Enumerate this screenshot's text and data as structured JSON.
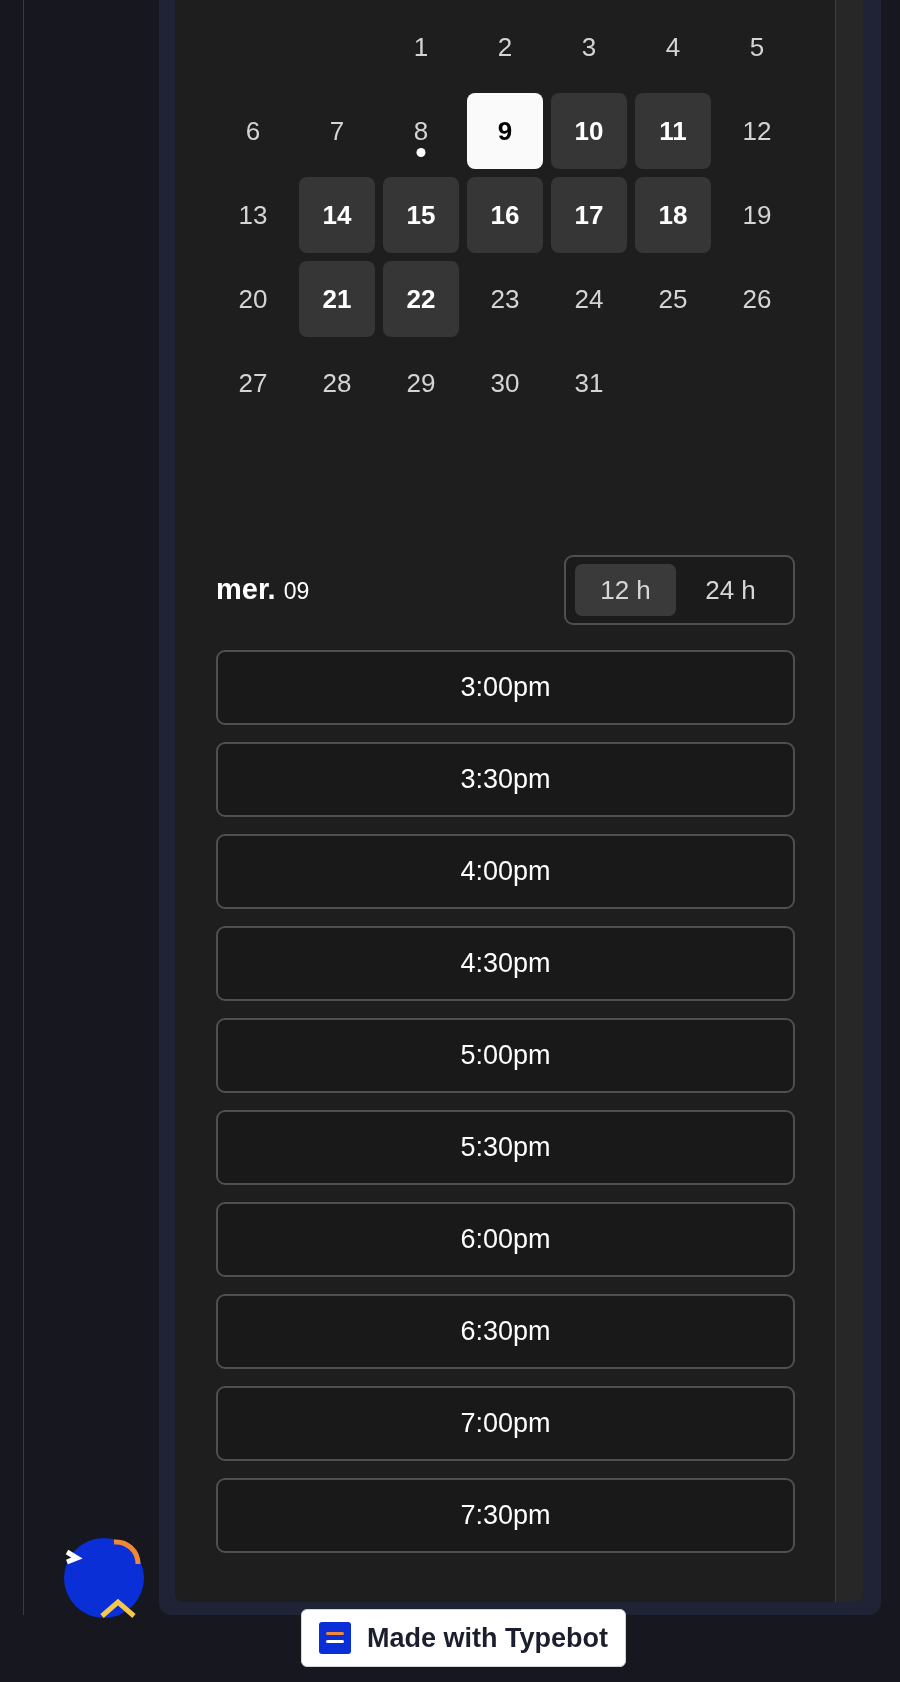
{
  "calendar": {
    "weeks": [
      {
        "kind": "first",
        "days": [
          {
            "label": "1",
            "selected": false,
            "available": false,
            "today": false
          },
          {
            "label": "2",
            "selected": false,
            "available": false,
            "today": false
          },
          {
            "label": "3",
            "selected": false,
            "available": false,
            "today": false
          },
          {
            "label": "4",
            "selected": false,
            "available": false,
            "today": false
          },
          {
            "label": "5",
            "selected": false,
            "available": false,
            "today": false
          }
        ]
      },
      {
        "kind": "full",
        "days": [
          {
            "label": "6",
            "selected": false,
            "available": false,
            "today": false
          },
          {
            "label": "7",
            "selected": false,
            "available": false,
            "today": false
          },
          {
            "label": "8",
            "selected": false,
            "available": false,
            "today": true
          },
          {
            "label": "9",
            "selected": true,
            "available": true,
            "today": false
          },
          {
            "label": "10",
            "selected": false,
            "available": true,
            "today": false
          },
          {
            "label": "11",
            "selected": false,
            "available": true,
            "today": false
          },
          {
            "label": "12",
            "selected": false,
            "available": false,
            "today": false
          }
        ]
      },
      {
        "kind": "full",
        "days": [
          {
            "label": "13",
            "selected": false,
            "available": false,
            "today": false
          },
          {
            "label": "14",
            "selected": false,
            "available": true,
            "today": false
          },
          {
            "label": "15",
            "selected": false,
            "available": true,
            "today": false
          },
          {
            "label": "16",
            "selected": false,
            "available": true,
            "today": false
          },
          {
            "label": "17",
            "selected": false,
            "available": true,
            "today": false
          },
          {
            "label": "18",
            "selected": false,
            "available": true,
            "today": false
          },
          {
            "label": "19",
            "selected": false,
            "available": false,
            "today": false
          }
        ]
      },
      {
        "kind": "full",
        "days": [
          {
            "label": "20",
            "selected": false,
            "available": false,
            "today": false
          },
          {
            "label": "21",
            "selected": false,
            "available": true,
            "today": false
          },
          {
            "label": "22",
            "selected": false,
            "available": true,
            "today": false
          },
          {
            "label": "23",
            "selected": false,
            "available": false,
            "today": false
          },
          {
            "label": "24",
            "selected": false,
            "available": false,
            "today": false
          },
          {
            "label": "25",
            "selected": false,
            "available": false,
            "today": false
          },
          {
            "label": "26",
            "selected": false,
            "available": false,
            "today": false
          }
        ]
      },
      {
        "kind": "last",
        "days": [
          {
            "label": "27",
            "selected": false,
            "available": false,
            "today": false
          },
          {
            "label": "28",
            "selected": false,
            "available": false,
            "today": false
          },
          {
            "label": "29",
            "selected": false,
            "available": false,
            "today": false
          },
          {
            "label": "30",
            "selected": false,
            "available": false,
            "today": false
          },
          {
            "label": "31",
            "selected": false,
            "available": false,
            "today": false
          }
        ]
      }
    ]
  },
  "day_header": {
    "weekday": "mer.",
    "day": "09"
  },
  "format_toggle": [
    {
      "label": "12 h",
      "selected": true
    },
    {
      "label": "24 h",
      "selected": false
    }
  ],
  "time_slots": [
    "3:00pm",
    "3:30pm",
    "4:00pm",
    "4:30pm",
    "5:00pm",
    "5:30pm",
    "6:00pm",
    "6:30pm",
    "7:00pm",
    "7:30pm"
  ],
  "badge": {
    "label": "Made with Typebot"
  }
}
